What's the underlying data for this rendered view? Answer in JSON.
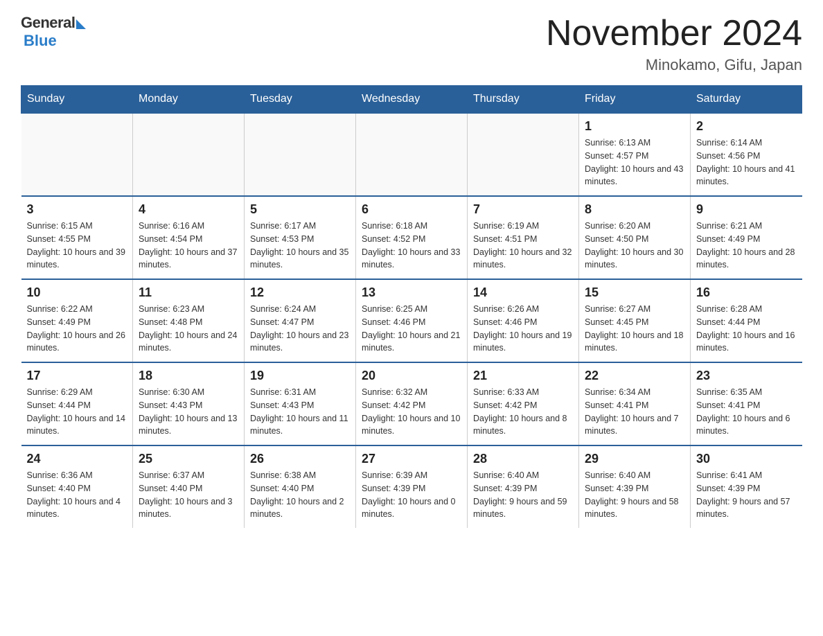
{
  "logo": {
    "general": "General",
    "blue": "Blue"
  },
  "title": "November 2024",
  "subtitle": "Minokamo, Gifu, Japan",
  "days_of_week": [
    "Sunday",
    "Monday",
    "Tuesday",
    "Wednesday",
    "Thursday",
    "Friday",
    "Saturday"
  ],
  "weeks": [
    [
      {
        "day": "",
        "info": ""
      },
      {
        "day": "",
        "info": ""
      },
      {
        "day": "",
        "info": ""
      },
      {
        "day": "",
        "info": ""
      },
      {
        "day": "",
        "info": ""
      },
      {
        "day": "1",
        "info": "Sunrise: 6:13 AM\nSunset: 4:57 PM\nDaylight: 10 hours and 43 minutes."
      },
      {
        "day": "2",
        "info": "Sunrise: 6:14 AM\nSunset: 4:56 PM\nDaylight: 10 hours and 41 minutes."
      }
    ],
    [
      {
        "day": "3",
        "info": "Sunrise: 6:15 AM\nSunset: 4:55 PM\nDaylight: 10 hours and 39 minutes."
      },
      {
        "day": "4",
        "info": "Sunrise: 6:16 AM\nSunset: 4:54 PM\nDaylight: 10 hours and 37 minutes."
      },
      {
        "day": "5",
        "info": "Sunrise: 6:17 AM\nSunset: 4:53 PM\nDaylight: 10 hours and 35 minutes."
      },
      {
        "day": "6",
        "info": "Sunrise: 6:18 AM\nSunset: 4:52 PM\nDaylight: 10 hours and 33 minutes."
      },
      {
        "day": "7",
        "info": "Sunrise: 6:19 AM\nSunset: 4:51 PM\nDaylight: 10 hours and 32 minutes."
      },
      {
        "day": "8",
        "info": "Sunrise: 6:20 AM\nSunset: 4:50 PM\nDaylight: 10 hours and 30 minutes."
      },
      {
        "day": "9",
        "info": "Sunrise: 6:21 AM\nSunset: 4:49 PM\nDaylight: 10 hours and 28 minutes."
      }
    ],
    [
      {
        "day": "10",
        "info": "Sunrise: 6:22 AM\nSunset: 4:49 PM\nDaylight: 10 hours and 26 minutes."
      },
      {
        "day": "11",
        "info": "Sunrise: 6:23 AM\nSunset: 4:48 PM\nDaylight: 10 hours and 24 minutes."
      },
      {
        "day": "12",
        "info": "Sunrise: 6:24 AM\nSunset: 4:47 PM\nDaylight: 10 hours and 23 minutes."
      },
      {
        "day": "13",
        "info": "Sunrise: 6:25 AM\nSunset: 4:46 PM\nDaylight: 10 hours and 21 minutes."
      },
      {
        "day": "14",
        "info": "Sunrise: 6:26 AM\nSunset: 4:46 PM\nDaylight: 10 hours and 19 minutes."
      },
      {
        "day": "15",
        "info": "Sunrise: 6:27 AM\nSunset: 4:45 PM\nDaylight: 10 hours and 18 minutes."
      },
      {
        "day": "16",
        "info": "Sunrise: 6:28 AM\nSunset: 4:44 PM\nDaylight: 10 hours and 16 minutes."
      }
    ],
    [
      {
        "day": "17",
        "info": "Sunrise: 6:29 AM\nSunset: 4:44 PM\nDaylight: 10 hours and 14 minutes."
      },
      {
        "day": "18",
        "info": "Sunrise: 6:30 AM\nSunset: 4:43 PM\nDaylight: 10 hours and 13 minutes."
      },
      {
        "day": "19",
        "info": "Sunrise: 6:31 AM\nSunset: 4:43 PM\nDaylight: 10 hours and 11 minutes."
      },
      {
        "day": "20",
        "info": "Sunrise: 6:32 AM\nSunset: 4:42 PM\nDaylight: 10 hours and 10 minutes."
      },
      {
        "day": "21",
        "info": "Sunrise: 6:33 AM\nSunset: 4:42 PM\nDaylight: 10 hours and 8 minutes."
      },
      {
        "day": "22",
        "info": "Sunrise: 6:34 AM\nSunset: 4:41 PM\nDaylight: 10 hours and 7 minutes."
      },
      {
        "day": "23",
        "info": "Sunrise: 6:35 AM\nSunset: 4:41 PM\nDaylight: 10 hours and 6 minutes."
      }
    ],
    [
      {
        "day": "24",
        "info": "Sunrise: 6:36 AM\nSunset: 4:40 PM\nDaylight: 10 hours and 4 minutes."
      },
      {
        "day": "25",
        "info": "Sunrise: 6:37 AM\nSunset: 4:40 PM\nDaylight: 10 hours and 3 minutes."
      },
      {
        "day": "26",
        "info": "Sunrise: 6:38 AM\nSunset: 4:40 PM\nDaylight: 10 hours and 2 minutes."
      },
      {
        "day": "27",
        "info": "Sunrise: 6:39 AM\nSunset: 4:39 PM\nDaylight: 10 hours and 0 minutes."
      },
      {
        "day": "28",
        "info": "Sunrise: 6:40 AM\nSunset: 4:39 PM\nDaylight: 9 hours and 59 minutes."
      },
      {
        "day": "29",
        "info": "Sunrise: 6:40 AM\nSunset: 4:39 PM\nDaylight: 9 hours and 58 minutes."
      },
      {
        "day": "30",
        "info": "Sunrise: 6:41 AM\nSunset: 4:39 PM\nDaylight: 9 hours and 57 minutes."
      }
    ]
  ]
}
